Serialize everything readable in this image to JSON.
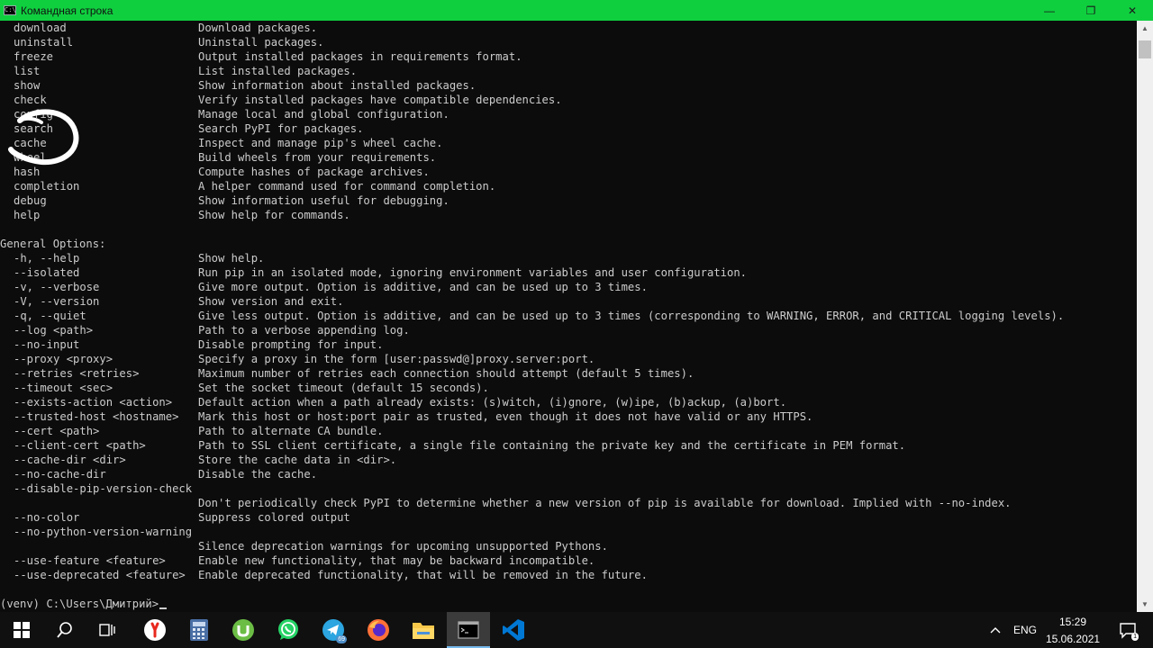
{
  "window": {
    "title": "Командная строка",
    "icon": "C:\\",
    "minimize": "—",
    "restore": "❐",
    "close": "✕"
  },
  "commands": [
    {
      "name": "download",
      "desc": "Download packages."
    },
    {
      "name": "uninstall",
      "desc": "Uninstall packages."
    },
    {
      "name": "freeze",
      "desc": "Output installed packages in requirements format."
    },
    {
      "name": "list",
      "desc": "List installed packages."
    },
    {
      "name": "show",
      "desc": "Show information about installed packages."
    },
    {
      "name": "check",
      "desc": "Verify installed packages have compatible dependencies."
    },
    {
      "name": "config",
      "desc": "Manage local and global configuration."
    },
    {
      "name": "search",
      "desc": "Search PyPI for packages."
    },
    {
      "name": "cache",
      "desc": "Inspect and manage pip's wheel cache."
    },
    {
      "name": "wheel",
      "desc": "Build wheels from your requirements."
    },
    {
      "name": "hash",
      "desc": "Compute hashes of package archives."
    },
    {
      "name": "completion",
      "desc": "A helper command used for command completion."
    },
    {
      "name": "debug",
      "desc": "Show information useful for debugging."
    },
    {
      "name": "help",
      "desc": "Show help for commands."
    }
  ],
  "general_heading": "General Options:",
  "options": [
    {
      "name": "-h, --help",
      "desc": "Show help."
    },
    {
      "name": "--isolated",
      "desc": "Run pip in an isolated mode, ignoring environment variables and user configuration."
    },
    {
      "name": "-v, --verbose",
      "desc": "Give more output. Option is additive, and can be used up to 3 times."
    },
    {
      "name": "-V, --version",
      "desc": "Show version and exit."
    },
    {
      "name": "-q, --quiet",
      "desc": "Give less output. Option is additive, and can be used up to 3 times (corresponding to WARNING, ERROR, and CRITICAL logging levels)."
    },
    {
      "name": "--log <path>",
      "desc": "Path to a verbose appending log."
    },
    {
      "name": "--no-input",
      "desc": "Disable prompting for input."
    },
    {
      "name": "--proxy <proxy>",
      "desc": "Specify a proxy in the form [user:passwd@]proxy.server:port."
    },
    {
      "name": "--retries <retries>",
      "desc": "Maximum number of retries each connection should attempt (default 5 times)."
    },
    {
      "name": "--timeout <sec>",
      "desc": "Set the socket timeout (default 15 seconds)."
    },
    {
      "name": "--exists-action <action>",
      "desc": "Default action when a path already exists: (s)witch, (i)gnore, (w)ipe, (b)ackup, (a)bort."
    },
    {
      "name": "--trusted-host <hostname>",
      "desc": "Mark this host or host:port pair as trusted, even though it does not have valid or any HTTPS."
    },
    {
      "name": "--cert <path>",
      "desc": "Path to alternate CA bundle."
    },
    {
      "name": "--client-cert <path>",
      "desc": "Path to SSL client certificate, a single file containing the private key and the certificate in PEM format."
    },
    {
      "name": "--cache-dir <dir>",
      "desc": "Store the cache data in <dir>."
    },
    {
      "name": "--no-cache-dir",
      "desc": "Disable the cache."
    },
    {
      "name": "--disable-pip-version-check",
      "desc": ""
    },
    {
      "name": "",
      "desc": "Don't periodically check PyPI to determine whether a new version of pip is available for download. Implied with --no-index."
    },
    {
      "name": "--no-color",
      "desc": "Suppress colored output"
    },
    {
      "name": "--no-python-version-warning",
      "desc": ""
    },
    {
      "name": "",
      "desc": "Silence deprecation warnings for upcoming unsupported Pythons."
    },
    {
      "name": "--use-feature <feature>",
      "desc": "Enable new functionality, that may be backward incompatible."
    },
    {
      "name": "--use-deprecated <feature>",
      "desc": "Enable deprecated functionality, that will be removed in the future."
    }
  ],
  "prompt": "(venv) C:\\Users\\Дмитрий>",
  "taskbar": {
    "telegram_badge": "69",
    "notification_badge": "1",
    "language": "ENG",
    "time": "15:29",
    "date": "15.06.2021"
  },
  "colors": {
    "titlebar": "#0fcf3f",
    "console_bg": "#0c0c0c",
    "console_text": "#cccccc",
    "taskbar": "#101010",
    "accent": "#76b9ed"
  }
}
